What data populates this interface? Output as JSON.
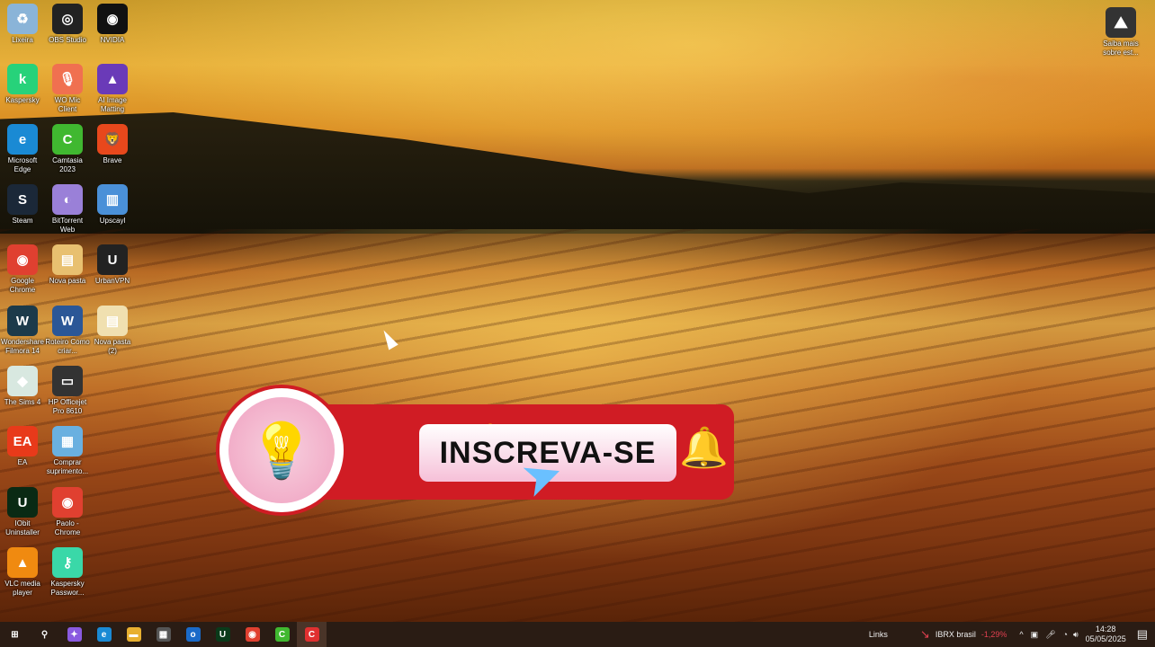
{
  "desktop": {
    "icons": [
      {
        "label": "Lixeira",
        "col": 0,
        "row": 0,
        "color": "#8ab4d8",
        "glyph": "♻"
      },
      {
        "label": "Kaspersky",
        "col": 0,
        "row": 1,
        "color": "#27d27a",
        "glyph": "k"
      },
      {
        "label": "Microsoft Edge",
        "col": 0,
        "row": 2,
        "color": "#1a8ad4",
        "glyph": "e"
      },
      {
        "label": "Steam",
        "col": 0,
        "row": 3,
        "color": "#1b2838",
        "glyph": "S"
      },
      {
        "label": "Google Chrome",
        "col": 0,
        "row": 4,
        "color": "#e04030",
        "glyph": "◉"
      },
      {
        "label": "Wondershare Filmora 14",
        "col": 0,
        "row": 5,
        "color": "#1c3a4a",
        "glyph": "W"
      },
      {
        "label": "The Sims 4",
        "col": 0,
        "row": 6,
        "color": "#d8e8e0",
        "glyph": "◆"
      },
      {
        "label": "EA",
        "col": 0,
        "row": 7,
        "color": "#e83a1a",
        "glyph": "EA"
      },
      {
        "label": "IObit Uninstaller",
        "col": 0,
        "row": 8,
        "color": "#0a2a14",
        "glyph": "U"
      },
      {
        "label": "VLC media player",
        "col": 0,
        "row": 9,
        "color": "#f08a10",
        "glyph": "▲"
      },
      {
        "label": "OBS Studio",
        "col": 1,
        "row": 0,
        "color": "#222",
        "glyph": "◎"
      },
      {
        "label": "WO Mic Client",
        "col": 1,
        "row": 1,
        "color": "#f07050",
        "glyph": "🎙"
      },
      {
        "label": "Camtasia 2023",
        "col": 1,
        "row": 2,
        "color": "#40b830",
        "glyph": "C"
      },
      {
        "label": "BitTorrent Web",
        "col": 1,
        "row": 3,
        "color": "#9a80d8",
        "glyph": "◐"
      },
      {
        "label": "Nova pasta",
        "col": 1,
        "row": 4,
        "color": "#e8c070",
        "glyph": "▤"
      },
      {
        "label": "Roteiro Como criar...",
        "col": 1,
        "row": 5,
        "color": "#2b5797",
        "glyph": "W"
      },
      {
        "label": "HP Officejet Pro 8610",
        "col": 1,
        "row": 6,
        "color": "#333",
        "glyph": "▭"
      },
      {
        "label": "Comprar suprimento...",
        "col": 1,
        "row": 7,
        "color": "#6ab0e0",
        "glyph": "▦"
      },
      {
        "label": "Paolo - Chrome",
        "col": 1,
        "row": 8,
        "color": "#e04030",
        "glyph": "◉"
      },
      {
        "label": "Kaspersky Passwor...",
        "col": 1,
        "row": 9,
        "color": "#3ad8a8",
        "glyph": "⚷"
      },
      {
        "label": "NVIDIA",
        "col": 2,
        "row": 0,
        "color": "#111",
        "glyph": "◉"
      },
      {
        "label": "AI Image Matting",
        "col": 2,
        "row": 1,
        "color": "#6a3ab8",
        "glyph": "▲"
      },
      {
        "label": "Brave",
        "col": 2,
        "row": 2,
        "color": "#e8481c",
        "glyph": "🦁"
      },
      {
        "label": "Upscayl",
        "col": 2,
        "row": 3,
        "color": "#4a90d8",
        "glyph": "▥"
      },
      {
        "label": "UrbanVPN",
        "col": 2,
        "row": 4,
        "color": "#222",
        "glyph": "U"
      },
      {
        "label": "Nova pasta (2)",
        "col": 2,
        "row": 5,
        "color": "#f0e0b0",
        "glyph": "▤"
      }
    ]
  },
  "spotlight": {
    "label": "Saiba mais sobre est..."
  },
  "banner": {
    "text": "INSCREVA-SE"
  },
  "taskbar": {
    "apps": [
      {
        "name": "start",
        "glyph": "⊞",
        "color": "transparent"
      },
      {
        "name": "search",
        "glyph": "⚲",
        "color": "transparent"
      },
      {
        "name": "copilot",
        "glyph": "✦",
        "color": "#8a5ae0"
      },
      {
        "name": "edge",
        "glyph": "e",
        "color": "#1a8ad4"
      },
      {
        "name": "file-explorer",
        "glyph": "▬",
        "color": "#e8b030"
      },
      {
        "name": "store",
        "glyph": "▦",
        "color": "#555"
      },
      {
        "name": "outlook",
        "glyph": "o",
        "color": "#1a6ac8"
      },
      {
        "name": "iobit",
        "glyph": "U",
        "color": "#0a3a1a"
      },
      {
        "name": "chrome",
        "glyph": "◉",
        "color": "#e04030"
      },
      {
        "name": "camtasia",
        "glyph": "C",
        "color": "#40b830"
      },
      {
        "name": "camtasia-recorder",
        "glyph": "C",
        "color": "#e03030"
      }
    ],
    "links": "Links",
    "stock": "IBRX brasil",
    "stock_change": "-1,29%",
    "time": "14:28",
    "date": "05/05/2025",
    "stock_color": "#e04050"
  }
}
